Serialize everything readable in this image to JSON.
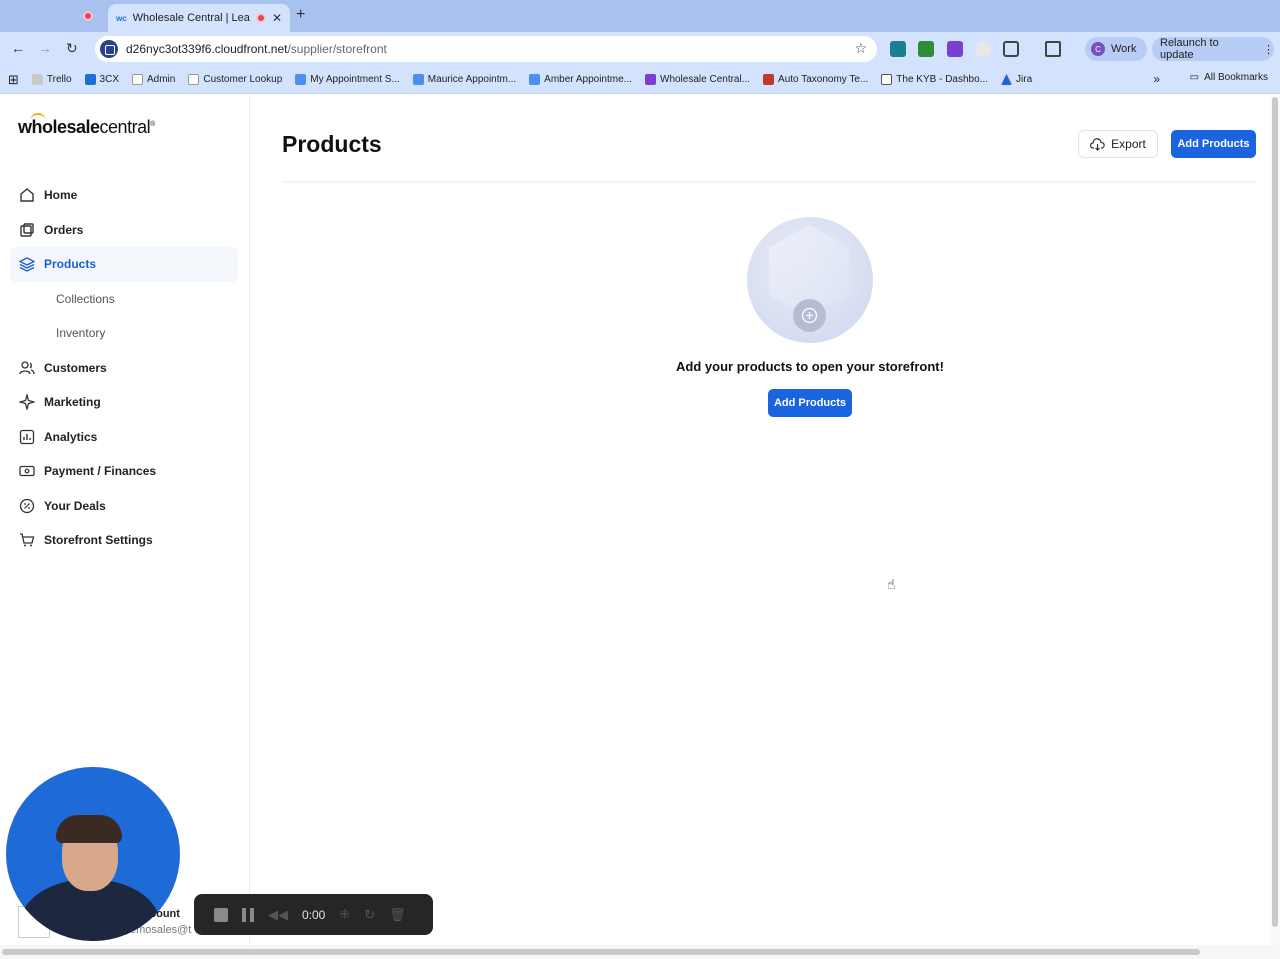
{
  "browser": {
    "active_tab_title": "Wholesale Central | Lead",
    "url_host": "d26nyc3ot339f6.cloudfront.net",
    "url_path": "/supplier/storefront",
    "profile_label": "Work",
    "profile_initial": "C",
    "relaunch_label": "Relaunch to update",
    "bookmarks": [
      "Trello",
      "3CX",
      "Admin",
      "Customer Lookup",
      "My Appointment S...",
      "Maurice Appointm...",
      "Amber Appointme...",
      "Wholesale Central...",
      "Auto Taxonomy Te...",
      "The KYB - Dashbo...",
      "Jira"
    ],
    "all_bookmarks_label": "All Bookmarks"
  },
  "sidebar": {
    "logo_light": "wholesale",
    "logo_rest": "central",
    "items": [
      {
        "label": "Home",
        "icon": "home-icon"
      },
      {
        "label": "Orders",
        "icon": "orders-icon"
      },
      {
        "label": "Products",
        "icon": "layers-icon",
        "active": true
      },
      {
        "label": "Collections",
        "sub": true
      },
      {
        "label": "Inventory",
        "sub": true
      },
      {
        "label": "Customers",
        "icon": "users-icon"
      },
      {
        "label": "Marketing",
        "icon": "sparkle-icon"
      },
      {
        "label": "Analytics",
        "icon": "chart-icon"
      },
      {
        "label": "Payment / Finances",
        "icon": "payment-icon"
      },
      {
        "label": "Your Deals",
        "icon": "percent-icon"
      },
      {
        "label": "Storefront Settings",
        "icon": "cart-icon"
      }
    ],
    "account_name_fragment": "count",
    "account_email_fragment": "emosales@t"
  },
  "main": {
    "title": "Products",
    "export_label": "Export",
    "add_products_label": "Add Products",
    "empty_message": "Add your products to open your storefront!",
    "empty_add_label": "Add Products"
  },
  "recorder": {
    "time": "0:00"
  },
  "colors": {
    "accent": "#1a64e0",
    "active_text": "#1a5fd6",
    "chrome": "#d3e3fd"
  }
}
